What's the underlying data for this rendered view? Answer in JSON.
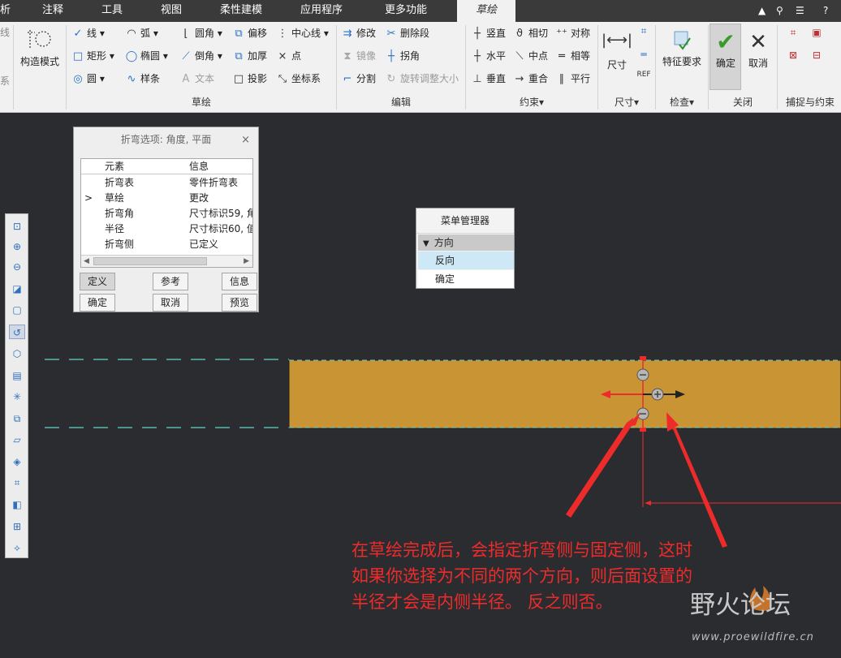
{
  "tabs": [
    "析",
    "注释",
    "工具",
    "视图",
    "柔性建模",
    "应用程序",
    "更多功能",
    "草绘"
  ],
  "window_controls": [
    "▲",
    "⚲",
    "☰",
    "?"
  ],
  "ribbon": {
    "left_group": {
      "edge_top": "线",
      "edge_bottom": "系",
      "construct_mode": "构造模式"
    },
    "sketch": {
      "line": "线",
      "arc": "弧",
      "fillet": "圆角",
      "offset": "偏移",
      "centerline": "中心线",
      "rect": "矩形",
      "ellipse": "椭圆",
      "chamfer": "倒角",
      "thicken": "加厚",
      "point": "点",
      "circle": "圆",
      "spline": "样条",
      "text": "文本",
      "project": "投影",
      "csys": "坐标系",
      "group_label": "草绘"
    },
    "edit": {
      "modify": "修改",
      "delete_segment": "删除段",
      "mirror": "镜像",
      "corner": "拐角",
      "divide": "分割",
      "rotate_resize": "旋转调整大小",
      "group_label": "编辑"
    },
    "constrain": {
      "vertical": "竖直",
      "tangent": "相切",
      "symmetric": "对称",
      "horizontal": "水平",
      "midpoint": "中点",
      "equal": "相等",
      "perpendicular": "垂直",
      "coincident": "重合",
      "parallel": "平行",
      "group_label": "约束▾"
    },
    "dimension": {
      "label": "尺寸",
      "group_label": "尺寸▾"
    },
    "inspect": {
      "label": "特征要求",
      "group_label": "检查▾"
    },
    "close": {
      "ok": "确定",
      "cancel": "取消",
      "group_label": "关闭"
    },
    "snap": {
      "group_label": "捕捉与约束"
    }
  },
  "dialog": {
    "title": "折弯选项: 角度, 平面",
    "close": "×",
    "headers": [
      "元素",
      "信息"
    ],
    "rows": [
      {
        "marker": "",
        "element": "折弯表",
        "info": "零件折弯表"
      },
      {
        "marker": ">",
        "element": "草绘",
        "info": "更改"
      },
      {
        "marker": "",
        "element": "折弯角",
        "info": "尺寸标识59, 角"
      },
      {
        "marker": "",
        "element": "半径",
        "info": "尺寸标识60, 值"
      },
      {
        "marker": "",
        "element": "折弯侧",
        "info": "已定义"
      }
    ],
    "buttons": {
      "define": "定义",
      "reference": "参考",
      "info": "信息",
      "ok": "确定",
      "cancel": "取消",
      "preview": "预览"
    }
  },
  "menu_manager": {
    "title": "菜单管理器",
    "section": "方向",
    "items": [
      "反向",
      "确定"
    ]
  },
  "annotation": "在草绘完成后，会指定折弯侧与固定侧，这时如果你选择为不同的两个方向，则后面设置的半径才会是内侧半径。 反之则否。",
  "watermark": {
    "main": "野火论坛",
    "url": "www.proewildfire.cn"
  },
  "colors": {
    "part": "#c99433",
    "sketch_dash": "#66d2cc",
    "arrow_red": "#ee2b2b",
    "accent": "#2a70c8"
  }
}
